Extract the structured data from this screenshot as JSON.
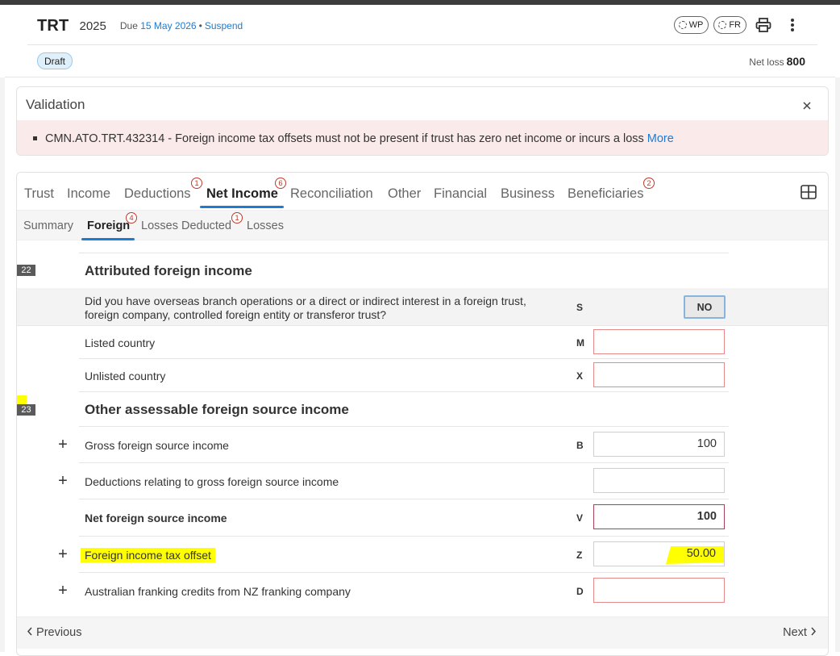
{
  "header": {
    "title": "TRT",
    "year": "2025",
    "due_prefix": "Due",
    "due_date": "15 May 2026",
    "separator": "•",
    "suspend": "Suspend",
    "wp": "WP",
    "fr": "FR",
    "status": "Draft",
    "net_loss_label": "Net loss",
    "net_loss_value": "800"
  },
  "validation": {
    "title": "Validation",
    "message": "CMN.ATO.TRT.432314 - Foreign income tax offsets must not be present if trust has zero net income or incurs a loss",
    "more": "More"
  },
  "tabs": [
    {
      "label": "Trust",
      "badge": ""
    },
    {
      "label": "Income",
      "badge": ""
    },
    {
      "label": "Deductions",
      "badge": "1"
    },
    {
      "label": "Net Income",
      "badge": "6"
    },
    {
      "label": "Reconciliation",
      "badge": ""
    },
    {
      "label": "Other",
      "badge": ""
    },
    {
      "label": "Financial",
      "badge": ""
    },
    {
      "label": "Business",
      "badge": ""
    },
    {
      "label": "Beneficiaries",
      "badge": "2"
    }
  ],
  "subtabs": [
    {
      "label": "Summary",
      "badge": ""
    },
    {
      "label": "Foreign",
      "badge": "4"
    },
    {
      "label": "Losses Deducted",
      "badge": "1"
    },
    {
      "label": "Losses",
      "badge": ""
    }
  ],
  "sections": {
    "s22": {
      "number": "22",
      "title": "Attributed foreign income",
      "question_line1": "Did you have overseas branch operations or a direct or indirect interest in a foreign trust,",
      "question_line2": "foreign company, controlled foreign entity or transferor trust?",
      "question_code": "S",
      "question_answer": "NO",
      "listed_label": "Listed country",
      "listed_code": "M",
      "listed_value": "",
      "unlisted_label": "Unlisted country",
      "unlisted_code": "X",
      "unlisted_value": ""
    },
    "s23": {
      "number": "23",
      "title": "Other assessable foreign source income",
      "gross_label": "Gross foreign source income",
      "gross_code": "B",
      "gross_value": "100",
      "deductions_label": "Deductions relating to gross foreign source income",
      "deductions_value": "",
      "net_label": "Net foreign source income",
      "net_code": "V",
      "net_value": "100",
      "offset_label": "Foreign income tax offset",
      "offset_code": "Z",
      "offset_value": "50.00",
      "nz_label": "Australian franking credits from NZ franking company",
      "nz_code": "D",
      "nz_value": ""
    }
  },
  "footer": {
    "previous": "Previous",
    "next": "Next"
  },
  "colors": {
    "accent": "#1e7bd2",
    "error_bg": "#fbeaea",
    "highlight": "#ffff00",
    "badge": "#c0392b"
  }
}
